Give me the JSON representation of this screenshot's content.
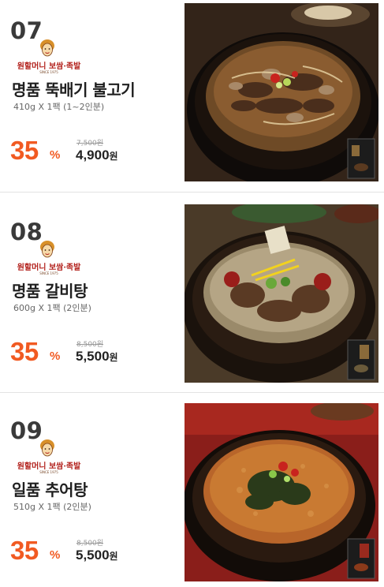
{
  "products": [
    {
      "number": "07",
      "brand_logo_text": "원할머니 보쌈·족발",
      "brand_logo_since": "SINCE 1975",
      "name": "명품 뚝배기 불고기",
      "spec": "410g X 1팩 (1~2인분)",
      "discount": "35",
      "discount_unit": "%",
      "original_price": "7,500원",
      "sale_price": "4,900",
      "sale_unit": "원",
      "photo_icon": "bulgogi-hotpot-photo"
    },
    {
      "number": "08",
      "brand_logo_text": "원할머니 보쌈·족발",
      "brand_logo_since": "SINCE 1975",
      "name": "명품 갈비탕",
      "spec": "600g X 1팩 (2인분)",
      "discount": "35",
      "discount_unit": "%",
      "original_price": "8,500원",
      "sale_price": "5,500",
      "sale_unit": "원",
      "photo_icon": "galbitang-photo"
    },
    {
      "number": "09",
      "brand_logo_text": "원할머니 보쌈·족발",
      "brand_logo_since": "SINCE 1975",
      "name": "일품 추어탕",
      "spec": "510g X 1팩 (2인분)",
      "discount": "35",
      "discount_unit": "%",
      "original_price": "8,500원",
      "sale_price": "5,500",
      "sale_unit": "원",
      "photo_icon": "chueotang-photo"
    }
  ],
  "colors": {
    "discount": "#f15a22",
    "logo_red": "#b3231e",
    "divider": "#e3e3e3"
  }
}
